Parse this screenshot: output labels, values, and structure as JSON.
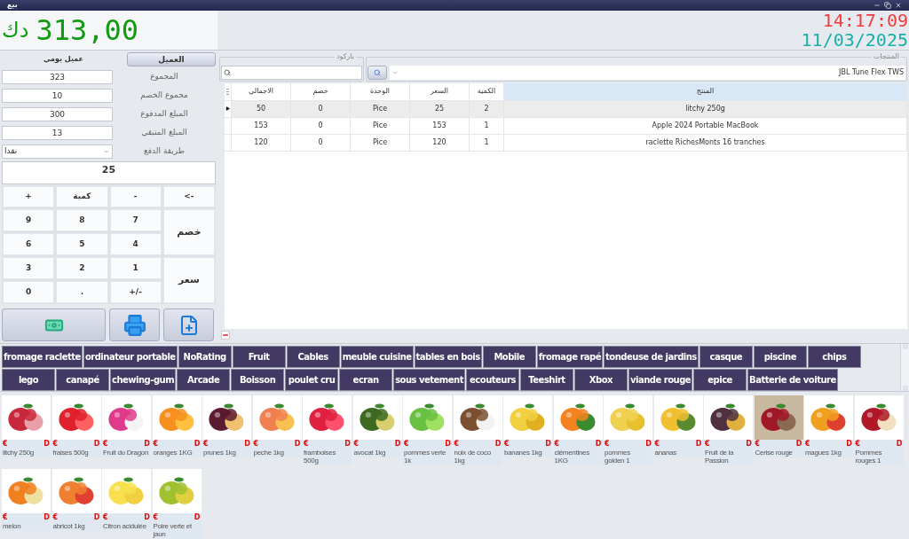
{
  "window": {
    "title": "بيع"
  },
  "total": {
    "amount": "313,00",
    "currency": "دك"
  },
  "clock": {
    "time": "14:17:09",
    "date": "11/03/2025"
  },
  "customer": {
    "name": "عميل يومي",
    "button": "العميل"
  },
  "fields": [
    {
      "label": "المجموع",
      "value": "323"
    },
    {
      "label": "مجموع الخصم",
      "value": "10"
    },
    {
      "label": "المبلغ المدفوع",
      "value": "300"
    },
    {
      "label": "المبلغ المتبقي",
      "value": "13"
    }
  ],
  "payment": {
    "label": "طريقة الدفع",
    "value": "نقدا"
  },
  "display": "25",
  "keypad": [
    {
      "text": "+",
      "kind": "key"
    },
    {
      "text": "كمية",
      "kind": "key"
    },
    {
      "text": "-",
      "kind": "key"
    },
    {
      "text": "<-",
      "kind": "key"
    },
    {
      "text": "9",
      "kind": "key"
    },
    {
      "text": "8",
      "kind": "key"
    },
    {
      "text": "7",
      "kind": "key"
    },
    {
      "text": "خصم",
      "kind": "tall"
    },
    {
      "text": "6",
      "kind": "key"
    },
    {
      "text": "5",
      "kind": "key"
    },
    {
      "text": "4",
      "kind": "key"
    },
    {
      "text": "3",
      "kind": "key"
    },
    {
      "text": "2",
      "kind": "key"
    },
    {
      "text": "1",
      "kind": "key"
    },
    {
      "text": "سعر",
      "kind": "tall"
    },
    {
      "text": "0",
      "kind": "key"
    },
    {
      "text": ".",
      "kind": "key"
    },
    {
      "text": "+/-",
      "kind": "key"
    }
  ],
  "barcode": {
    "legend": "باركود"
  },
  "products_search": {
    "legend": "المنتجات",
    "value": "JBL Tune Flex TWS"
  },
  "table": {
    "columns": [
      {
        "label": "الاجمالي",
        "selected": false
      },
      {
        "label": "خصم",
        "selected": false
      },
      {
        "label": "الوحدة",
        "selected": false
      },
      {
        "label": "السعر",
        "selected": false
      },
      {
        "label": "الكمية",
        "selected": false
      },
      {
        "label": "المنتج",
        "selected": true
      }
    ],
    "rows": [
      {
        "selected": true,
        "cells": [
          "50",
          "0",
          "Pice",
          "25",
          "2",
          "litchy 250g"
        ]
      },
      {
        "selected": false,
        "cells": [
          "153",
          "0",
          "Pice",
          "153",
          "1",
          "Apple 2024 Portable MacBook"
        ]
      },
      {
        "selected": false,
        "cells": [
          "120",
          "0",
          "Pice",
          "120",
          "1",
          "raclette RichesMonts 16 tranches"
        ]
      }
    ]
  },
  "categories": [
    [
      "fromage raclette",
      "ordinateur portable",
      "NoRating",
      "Fruit",
      "Cables",
      "meuble cuisine",
      "tables en bois",
      "Mobile",
      "fromage rapé",
      "tondeuse de jardins",
      "casque",
      "piscine",
      "chips"
    ],
    [
      "lego",
      "canapé",
      "chewing-gum",
      "Arcade",
      "Boisson",
      "poulet cru",
      "ecran",
      "sous vetement",
      "ecouteurs",
      "Teeshirt",
      "Xbox",
      "viande rouge",
      "epice",
      "Batterie de voiture"
    ]
  ],
  "products": [
    {
      "name": "litchy 250g",
      "currency": "€",
      "badge": "D"
    },
    {
      "name": "fraises 500g",
      "currency": "€",
      "badge": "D"
    },
    {
      "name": "Fruit du Dragon",
      "currency": "€",
      "badge": "D"
    },
    {
      "name": "oranges 1KG",
      "currency": "€",
      "badge": "D"
    },
    {
      "name": "prunes 1kg",
      "currency": "€",
      "badge": "D"
    },
    {
      "name": "peche 1kg",
      "currency": "€",
      "badge": "D"
    },
    {
      "name": "framboises 500g",
      "currency": "€",
      "badge": "D"
    },
    {
      "name": "avocat 1kg",
      "currency": "€",
      "badge": "D"
    },
    {
      "name": "pommes verte 1k",
      "currency": "€",
      "badge": "D"
    },
    {
      "name": "noix de coco 1kg",
      "currency": "€",
      "badge": "D"
    },
    {
      "name": "bananes 1kg",
      "currency": "€",
      "badge": "D"
    },
    {
      "name": "clémentines 1KG",
      "currency": "€",
      "badge": "D"
    },
    {
      "name": "pommes golden 1",
      "currency": "€",
      "badge": "D"
    },
    {
      "name": "ananas",
      "currency": "€",
      "badge": "D"
    },
    {
      "name": "Fruit de la Passion",
      "currency": "€",
      "badge": "D"
    },
    {
      "name": "Cerise rouge",
      "currency": "€",
      "badge": "D"
    },
    {
      "name": "magues 1kg",
      "currency": "€",
      "badge": "D"
    },
    {
      "name": "Pommes rouges 1",
      "currency": "€",
      "badge": "D"
    },
    {
      "name": "melon",
      "currency": "€",
      "badge": "D"
    },
    {
      "name": "abricot 1kg",
      "currency": "€",
      "badge": "D"
    },
    {
      "name": "Citron acidulée",
      "currency": "€",
      "badge": "D"
    },
    {
      "name": "Poire verte et jaun",
      "currency": "€",
      "badge": "D"
    }
  ]
}
